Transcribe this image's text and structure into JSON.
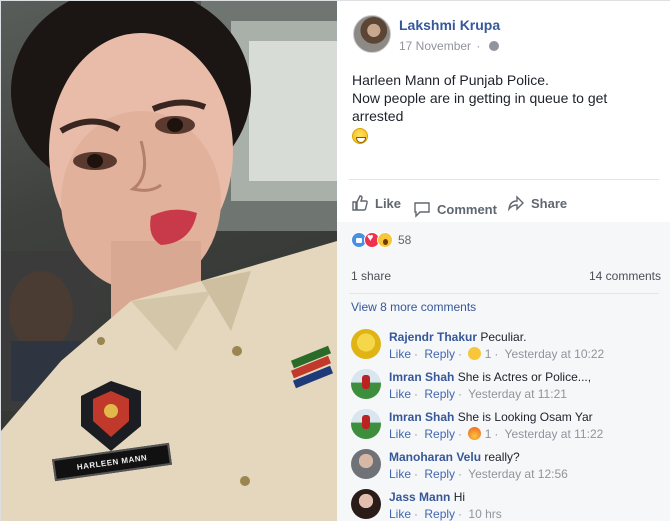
{
  "post": {
    "author": "Lakshmi Krupa",
    "date": "17 November",
    "text_line1": "Harleen Mann of Punjab Police.",
    "text_line2": "Now people are in getting in queue to get arrested"
  },
  "photo": {
    "name_tag": "HARLEEN MANN"
  },
  "actions": {
    "like": "Like",
    "comment": "Comment",
    "share": "Share"
  },
  "reactions": {
    "count": "58"
  },
  "stats": {
    "shares": "1 share",
    "comments": "14 comments"
  },
  "comments": {
    "view_more": "View 8 more comments",
    "like_label": "Like",
    "reply_label": "Reply",
    "items": [
      {
        "name": "Rajendr Thakur",
        "text": "Peculiar.",
        "reaction_count": "1",
        "time": "Yesterday at 10:22",
        "avatar_color": "#e6c21a",
        "reaction": "haha"
      },
      {
        "name": "Imran Shah",
        "text": "She is Actres or Police...,",
        "reaction_count": "",
        "time": "Yesterday at 11:21",
        "avatar_color": "#2e7d32",
        "reaction": ""
      },
      {
        "name": "Imran Shah",
        "text": "She is Looking Osam Yar",
        "reaction_count": "1",
        "time": "Yesterday at 11:22",
        "avatar_color": "#2e7d32",
        "reaction": "angry"
      },
      {
        "name": "Manoharan Velu",
        "text": "really?",
        "reaction_count": "",
        "time": "Yesterday at 12:56",
        "avatar_color": "#8a8f98",
        "reaction": ""
      },
      {
        "name": "Jass Mann",
        "text": "Hi",
        "reaction_count": "",
        "time": "10 hrs",
        "avatar_color": "#c7a08f",
        "reaction": ""
      }
    ]
  }
}
